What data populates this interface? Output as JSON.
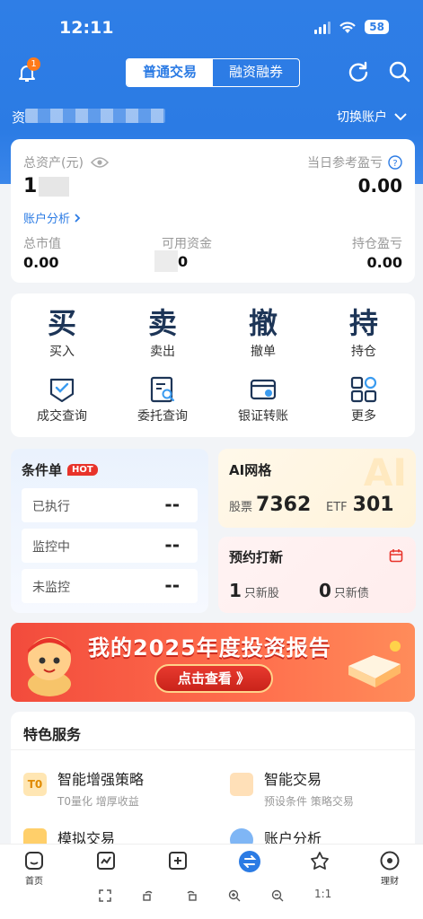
{
  "status": {
    "time": "12:11",
    "battery": "58"
  },
  "header": {
    "notification_count": "1",
    "tabs": [
      {
        "label": "普通交易",
        "active": true
      },
      {
        "label": "融资融券",
        "active": false
      }
    ],
    "account_label": "资",
    "switch_account": "切换账户"
  },
  "assets": {
    "total_label": "总资产(元)",
    "total_value": "1",
    "daily_pnl_label": "当日参考盈亏",
    "daily_pnl_value": "0.00",
    "analysis_link": "账户分析",
    "market_value_label": "总市值",
    "market_value": "0.00",
    "available_label": "可用资金",
    "available_value": "0",
    "position_pnl_label": "持仓盈亏",
    "position_pnl_value": "0.00"
  },
  "quick_actions": {
    "buy": {
      "glyph": "买",
      "label": "买入"
    },
    "sell": {
      "glyph": "卖",
      "label": "卖出"
    },
    "cancel": {
      "glyph": "撤",
      "label": "撤单"
    },
    "hold": {
      "glyph": "持",
      "label": "持仓"
    },
    "deals": {
      "label": "成交查询"
    },
    "orders": {
      "label": "委托查询"
    },
    "transfer": {
      "label": "银证转账"
    },
    "more": {
      "label": "更多"
    }
  },
  "conditional": {
    "title": "条件单",
    "badge": "HOT",
    "rows": [
      {
        "label": "已执行",
        "value": "--"
      },
      {
        "label": "监控中",
        "value": "--"
      },
      {
        "label": "未监控",
        "value": "--"
      }
    ]
  },
  "ai_grid": {
    "title": "AI网格",
    "stock_label": "股票",
    "stock_value": "7362",
    "etf_label": "ETF",
    "etf_value": "301"
  },
  "ipo": {
    "title": "预约打新",
    "new_stock_count": "1",
    "new_stock_label": "只新股",
    "new_bond_count": "0",
    "new_bond_label": "只新债"
  },
  "banner": {
    "title": "我的2025年度投资报告",
    "button": "点击查看 》"
  },
  "special_services": {
    "title": "特色服务",
    "items": [
      {
        "title": "智能增强策略",
        "subtitle": "T0量化 增厚收益",
        "icon_text": "T0"
      },
      {
        "title": "智能交易",
        "subtitle": "预设条件 策略交易"
      },
      {
        "title": "模拟交易",
        "subtitle": ""
      },
      {
        "title": "账户分析",
        "subtitle": ""
      }
    ]
  },
  "tabbar": {
    "home": "首页",
    "wealth": "理财"
  },
  "toolbar": {
    "ratio": "1:1"
  },
  "colors": {
    "primary": "#2b7be4",
    "hot": "#e8332a",
    "accent_orange": "#ff7a1a"
  }
}
